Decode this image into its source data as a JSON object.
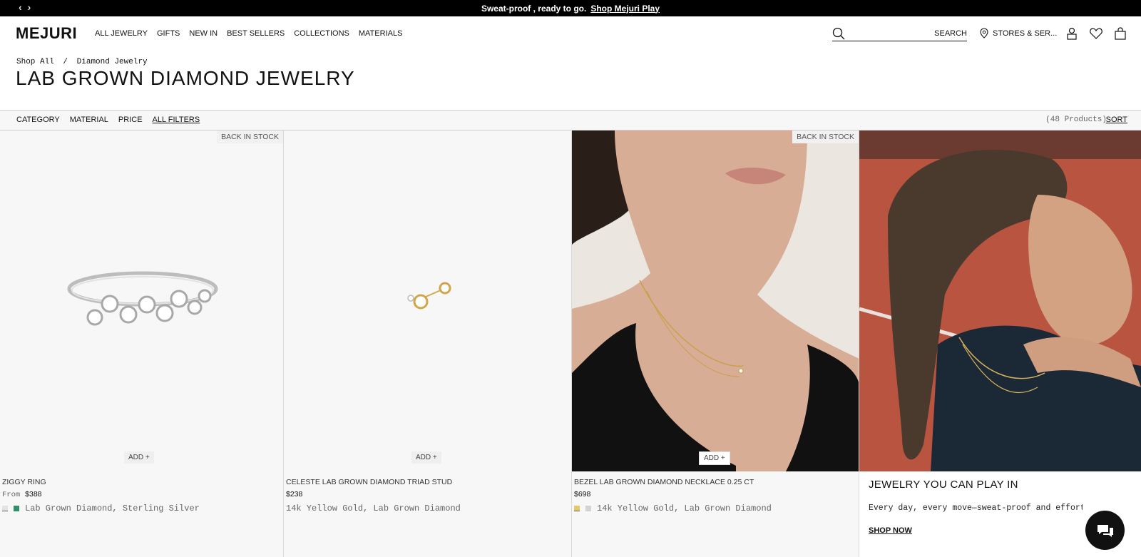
{
  "announcement": {
    "text": "Sweat-proof , ready to go.",
    "link": "Shop Mejuri Play"
  },
  "header": {
    "logo": "MEJURI",
    "nav": [
      "ALL JEWELRY",
      "GIFTS",
      "NEW IN",
      "BEST SELLERS",
      "COLLECTIONS",
      "MATERIALS"
    ],
    "search_label": "SEARCH",
    "stores_label": "STORES & SER..."
  },
  "breadcrumb": {
    "home": "Shop All",
    "sep": "/",
    "current": "Diamond Jewelry"
  },
  "page_title": "LAB GROWN DIAMOND JEWELRY",
  "filters": {
    "category": "CATEGORY",
    "material": "MATERIAL",
    "price": "PRICE",
    "all": "ALL FILTERS",
    "count": "(48 Products)",
    "sort": "SORT"
  },
  "products": [
    {
      "badge": "BACK IN STOCK",
      "add": "ADD +",
      "name": "ZIGGY RING",
      "price_prefix": "From",
      "price": "$388",
      "materials": "Lab Grown Diamond, Sterling Silver",
      "swatches": [
        "#d9d9d9",
        "#2f8f6b"
      ]
    },
    {
      "badge": "",
      "add": "ADD +",
      "name": "CELESTE LAB GROWN DIAMOND TRIAD STUD",
      "price_prefix": "",
      "price": "$238",
      "materials": "14k Yellow Gold, Lab Grown Diamond",
      "swatches": []
    },
    {
      "badge": "BACK IN STOCK",
      "add": "ADD +",
      "name": "BEZEL LAB GROWN DIAMOND NECKLACE 0.25 CT",
      "price_prefix": "",
      "price": "$698",
      "materials": "14k Yellow Gold, Lab Grown Diamond",
      "swatches": [
        "#e7c76d",
        "#d4d4d4"
      ]
    }
  ],
  "editorial": {
    "title": "JEWELRY YOU CAN PLAY IN",
    "body": "Every day, every move—sweat-proof and effortle",
    "link": "SHOP NOW"
  },
  "colors": {
    "accent": "#111111",
    "background": "#f7f7f7"
  }
}
